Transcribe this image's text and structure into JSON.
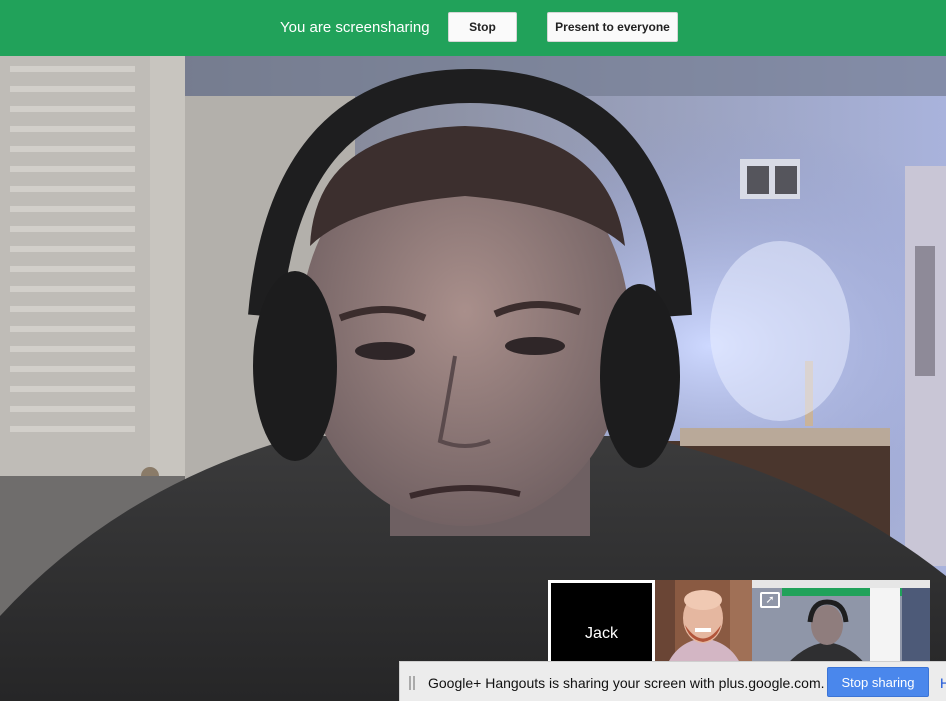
{
  "banner": {
    "status_text": "You are screensharing",
    "stop_label": "Stop",
    "present_label": "Present to everyone",
    "color": "#21a25a"
  },
  "participants": [
    {
      "name": "Jack",
      "state": "camera-off"
    },
    {
      "name": "",
      "state": "video"
    },
    {
      "name": "",
      "state": "screen-share",
      "icon": "share-screen-icon"
    }
  ],
  "share_bar": {
    "message": "Google+ Hangouts is sharing your screen with plus.google.com.",
    "stop_sharing_label": "Stop sharing",
    "hide_label": "H",
    "accent": "#4a87ec"
  }
}
